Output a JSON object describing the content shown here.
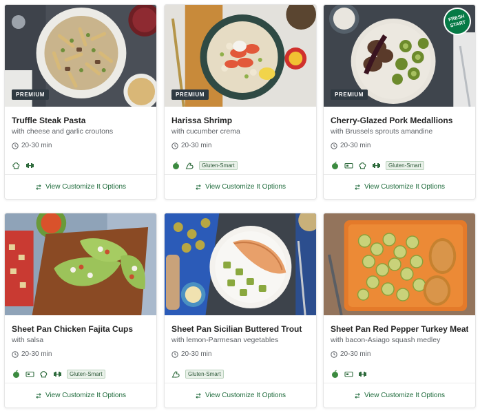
{
  "colors": {
    "accent_green": "#1d6a3a",
    "badge_dark": "#2f3a42",
    "pill_bg": "#e9f1e9"
  },
  "footer_label": "View Customize It Options",
  "footer_icon": "swap-arrows-icon",
  "time_icon": "clock-icon",
  "recipes": [
    {
      "title": "Truffle Steak Pasta",
      "subtitle": "with cheese and garlic croutons",
      "time": "20-30 min",
      "badge": "PREMIUM",
      "tag_icons": [
        "chef-hat-icon",
        "dumbbell-icon"
      ],
      "pill": ""
    },
    {
      "title": "Harissa Shrimp",
      "subtitle": "with cucumber crema",
      "time": "20-30 min",
      "badge": "PREMIUM",
      "tag_icons": [
        "apple-icon",
        "flexed-arm-icon"
      ],
      "pill": "Gluten-Smart"
    },
    {
      "title": "Cherry-Glazed Pork Medallions",
      "subtitle": "with Brussels sprouts amandine",
      "time": "20-30 min",
      "badge": "PREMIUM",
      "fresh_start": [
        "FRESH",
        "START"
      ],
      "tag_icons": [
        "apple-icon",
        "sheet-pan-icon",
        "chef-hat-icon",
        "dumbbell-icon"
      ],
      "pill": "Gluten-Smart"
    },
    {
      "title": "Sheet Pan Chicken Fajita Cups",
      "subtitle": "with salsa",
      "time": "20-30 min",
      "badge": "",
      "tag_icons": [
        "apple-icon",
        "sheet-pan-icon",
        "chef-hat-icon",
        "dumbbell-icon"
      ],
      "pill": "Gluten-Smart"
    },
    {
      "title": "Sheet Pan Sicilian Buttered Trout",
      "subtitle": "with lemon-Parmesan vegetables",
      "time": "20-30 min",
      "badge": "",
      "tag_icons": [
        "flexed-arm-icon"
      ],
      "pill": "Gluten-Smart"
    },
    {
      "title": "Sheet Pan Red Pepper Turkey Meatloaf",
      "subtitle": "with bacon-Asiago squash medley",
      "time": "20-30 min",
      "badge": "",
      "tag_icons": [
        "apple-icon",
        "sheet-pan-icon",
        "dumbbell-icon"
      ],
      "pill": ""
    }
  ]
}
